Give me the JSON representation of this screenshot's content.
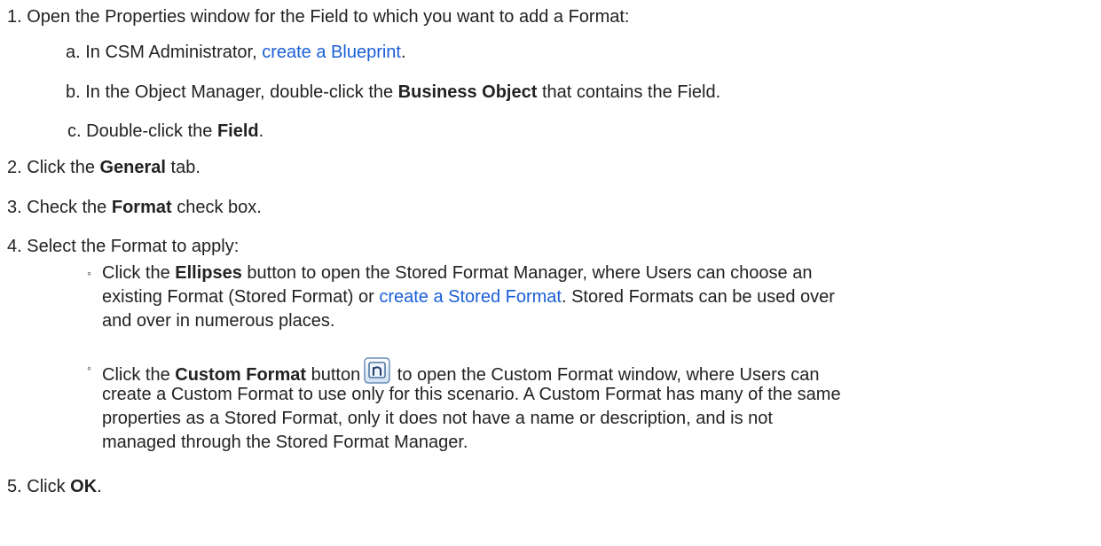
{
  "steps": {
    "s1": {
      "num": "1.",
      "text": "Open the Properties window for the Field to which you want to add a Format:",
      "a": {
        "letter": "a.",
        "pre": "In CSM Administrator, ",
        "link": "create a Blueprint",
        "post": "."
      },
      "b": {
        "letter": "b.",
        "pre": "In the Object Manager, double-click the ",
        "bold": "Business Object",
        "post": " that contains the Field."
      },
      "c": {
        "letter": "c.",
        "pre": "Double-click the ",
        "bold": "Field",
        "post": "."
      }
    },
    "s2": {
      "num": "2.",
      "pre": "Click the ",
      "bold": "General",
      "post": " tab."
    },
    "s3": {
      "num": "3.",
      "pre": "Check the ",
      "bold": "Format",
      "post": " check box."
    },
    "s4": {
      "num": "4.",
      "text": "Select the Format to apply:",
      "bullet": "◦",
      "opt1": {
        "l1_pre": "Click the ",
        "l1_bold": "Ellipses",
        "l1_post": " button to open the Stored Format Manager, where Users can choose an",
        "l2_pre": "existing Format (Stored Format) or ",
        "l2_link": "create a Stored Format",
        "l2_post": ". Stored Formats can be used over",
        "l3": "and over in numerous places."
      },
      "opt2": {
        "l1_pre": "Click the ",
        "l1_bold": "Custom Format",
        "l1_mid": " button",
        "l1_post": " to open the Custom Format window, where Users can",
        "l2": "create a Custom Format to use only for this scenario. A Custom Format has many of the same",
        "l3": "properties as a Stored Format, only it does not have a name or description, and is not",
        "l4": "managed through the Stored Format Manager."
      }
    },
    "s5": {
      "num": "5.",
      "pre": "Click ",
      "bold": "OK",
      "post": "."
    }
  },
  "icons": {
    "custom_format_button": "custom-format-icon"
  },
  "colors": {
    "link": "#1a5fd6",
    "text": "#222222"
  }
}
